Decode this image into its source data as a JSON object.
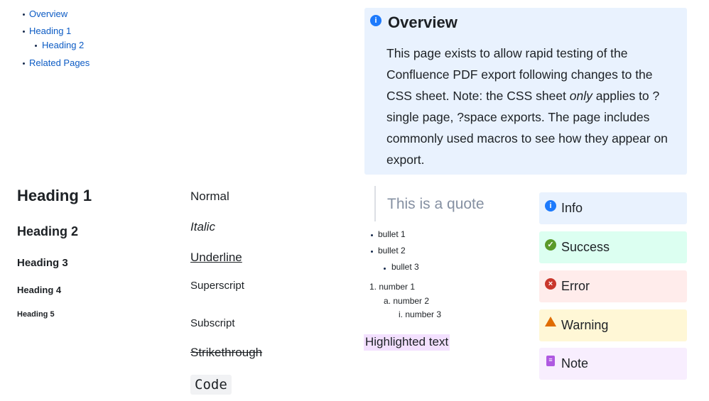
{
  "toc": {
    "items": [
      "Overview",
      "Heading 1",
      "Heading 2",
      "Related Pages"
    ]
  },
  "overview": {
    "title": "Overview",
    "body_pre": "This page exists to allow rapid testing of the Confluence PDF export following changes to the CSS sheet.  Note: the CSS sheet ",
    "body_em": "only",
    "body_post": " applies to ? single page, ?space exports.  The page includes commonly used macros to see how they appear on export."
  },
  "headings": [
    "Heading 1",
    "Heading 2",
    "Heading 3",
    "Heading 4",
    "Heading 5"
  ],
  "formats": {
    "normal": "Normal",
    "italic": "Italic",
    "underline": "Underline",
    "superscript": "Superscript",
    "subscript": "Subscript",
    "strikethrough": "Strikethrough",
    "code": "Code"
  },
  "quote": "This is a quote",
  "bullets": [
    "bullet 1",
    "bullet 2",
    "bullet 3"
  ],
  "numbers": [
    {
      "marker": "1.",
      "text": "number 1"
    },
    {
      "marker": "a.",
      "text": "number 2"
    },
    {
      "marker": "i.",
      "text": "number 3"
    }
  ],
  "highlight": "Highlighted text",
  "panels": [
    {
      "label": "Info",
      "icon": "info-icon",
      "bg": "#e9f2fe",
      "color": "#1d7afc"
    },
    {
      "label": "Success",
      "icon": "check-icon",
      "bg": "#dcfff1",
      "color": "#5b9a2a"
    },
    {
      "label": "Error",
      "icon": "error-icon",
      "bg": "#ffeceb",
      "color": "#c9372c"
    },
    {
      "label": "Warning",
      "icon": "warning-icon",
      "bg": "#fff7d6",
      "color": "#e06c00"
    },
    {
      "label": "Note",
      "icon": "note-icon",
      "bg": "#f8eefe",
      "color": "#af59e1"
    }
  ]
}
